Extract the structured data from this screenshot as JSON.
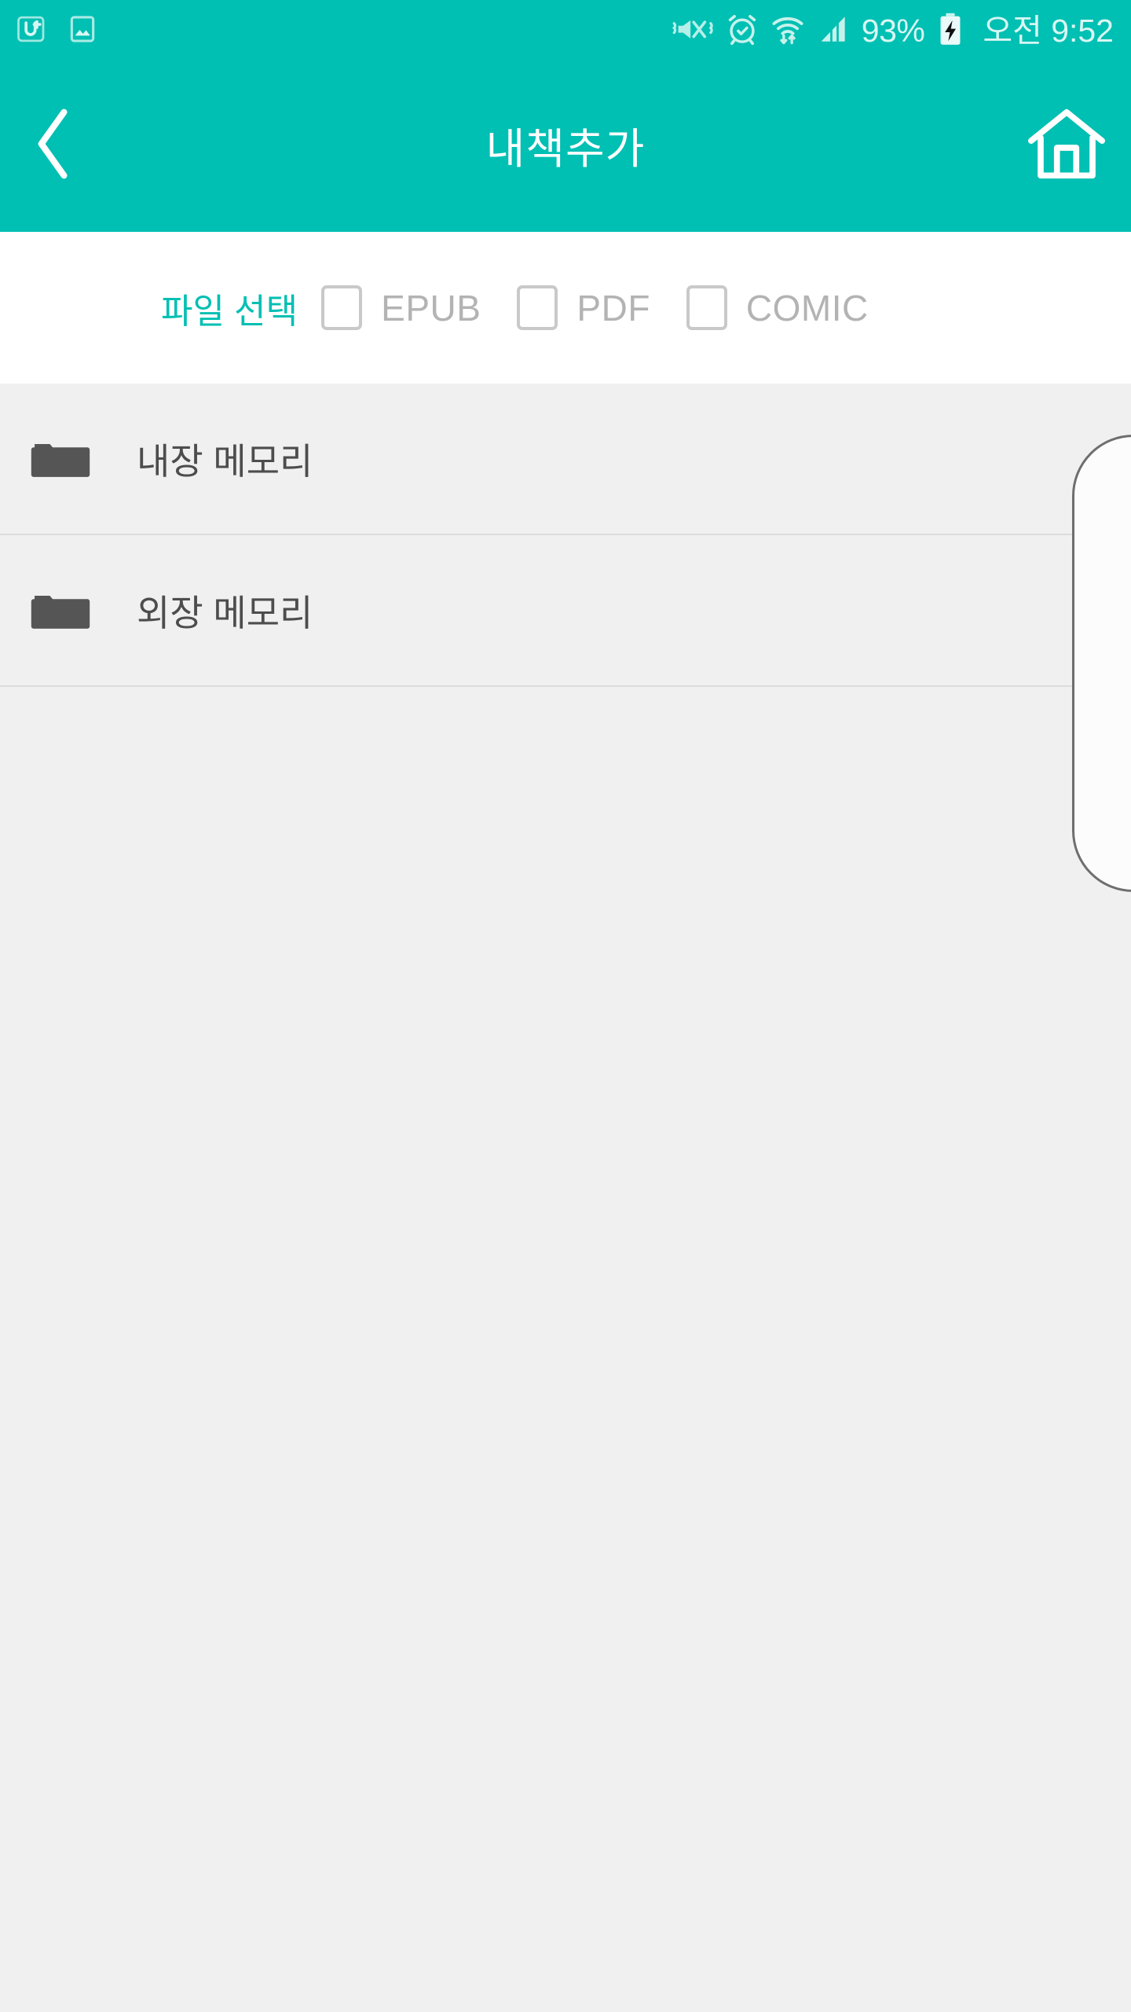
{
  "status_bar": {
    "background_color": "#00bfb3",
    "text_color": "#d8f7f3",
    "left_icons": [
      {
        "name": "app-notification-icon",
        "label": "U+"
      },
      {
        "name": "gallery-image-icon",
        "label": "image"
      }
    ],
    "right_icons": [
      {
        "name": "vibrate-mute-icon",
        "label": "mute"
      },
      {
        "name": "alarm-clock-icon",
        "label": "alarm"
      },
      {
        "name": "wifi-icon",
        "label": "wifi"
      },
      {
        "name": "cellular-signal-icon",
        "label": "signal"
      }
    ],
    "battery_percent": "93%",
    "battery_state": "charging",
    "clock": "오전 9:52"
  },
  "app_bar": {
    "background_color": "#00bfb3",
    "title": "내책추가",
    "back_icon": "chevron-left-icon",
    "home_icon": "home-icon"
  },
  "filter_bar": {
    "label": "파일 선택",
    "label_color": "#00bfb3",
    "options": [
      {
        "label": "EPUB",
        "checked": false
      },
      {
        "label": "PDF",
        "checked": false
      },
      {
        "label": "COMIC",
        "checked": false
      }
    ]
  },
  "file_list": {
    "items": [
      {
        "name": "내장 메모리",
        "icon": "folder-icon"
      },
      {
        "name": "외장 메모리",
        "icon": "folder-icon"
      }
    ]
  }
}
